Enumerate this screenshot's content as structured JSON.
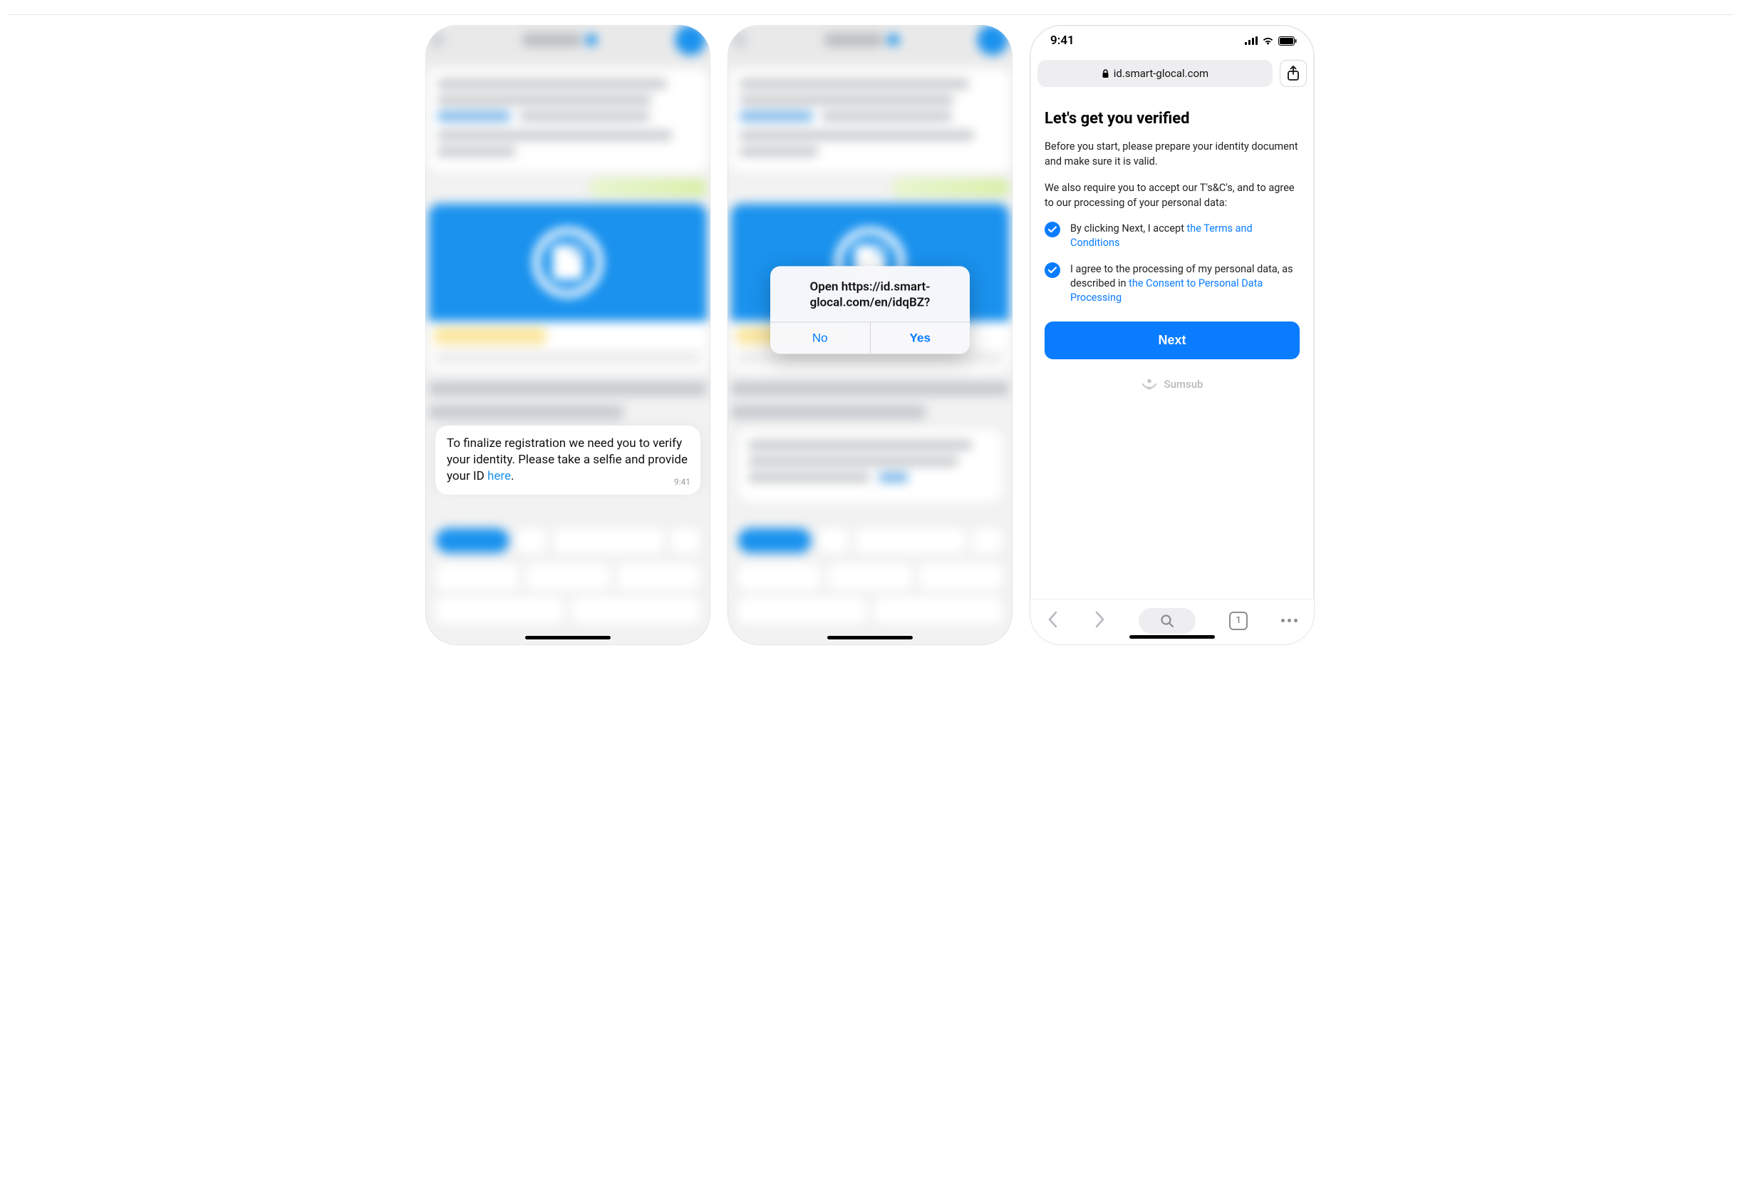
{
  "screen1": {
    "message_text_a": "To finalize registration we need you to verify your identity. Please take a selfie and provide your ID ",
    "message_link": "here",
    "message_text_b": ".",
    "timestamp": "9:41"
  },
  "screen2": {
    "alert_title": "Open https://id.smart-glocal.com/en/idqBZ?",
    "no_label": "No",
    "yes_label": "Yes"
  },
  "screen3": {
    "status_time": "9:41",
    "url_host": "id.smart-glocal.com",
    "title": "Let's get you verified",
    "intro1": "Before you start, please prepare your identity document and make sure it is valid.",
    "intro2": "We also require you to accept our T's&C's, and to agree to our processing of your personal data:",
    "check1_text": "By clicking Next, I accept ",
    "check1_link": "the Terms and Conditions",
    "check2_text_a": "I agree to the processing of my personal data, as described in ",
    "check2_link": "the Consent to Personal Data Processing",
    "next_label": "Next",
    "brand": "Sumsub",
    "tabs_count": "1"
  }
}
